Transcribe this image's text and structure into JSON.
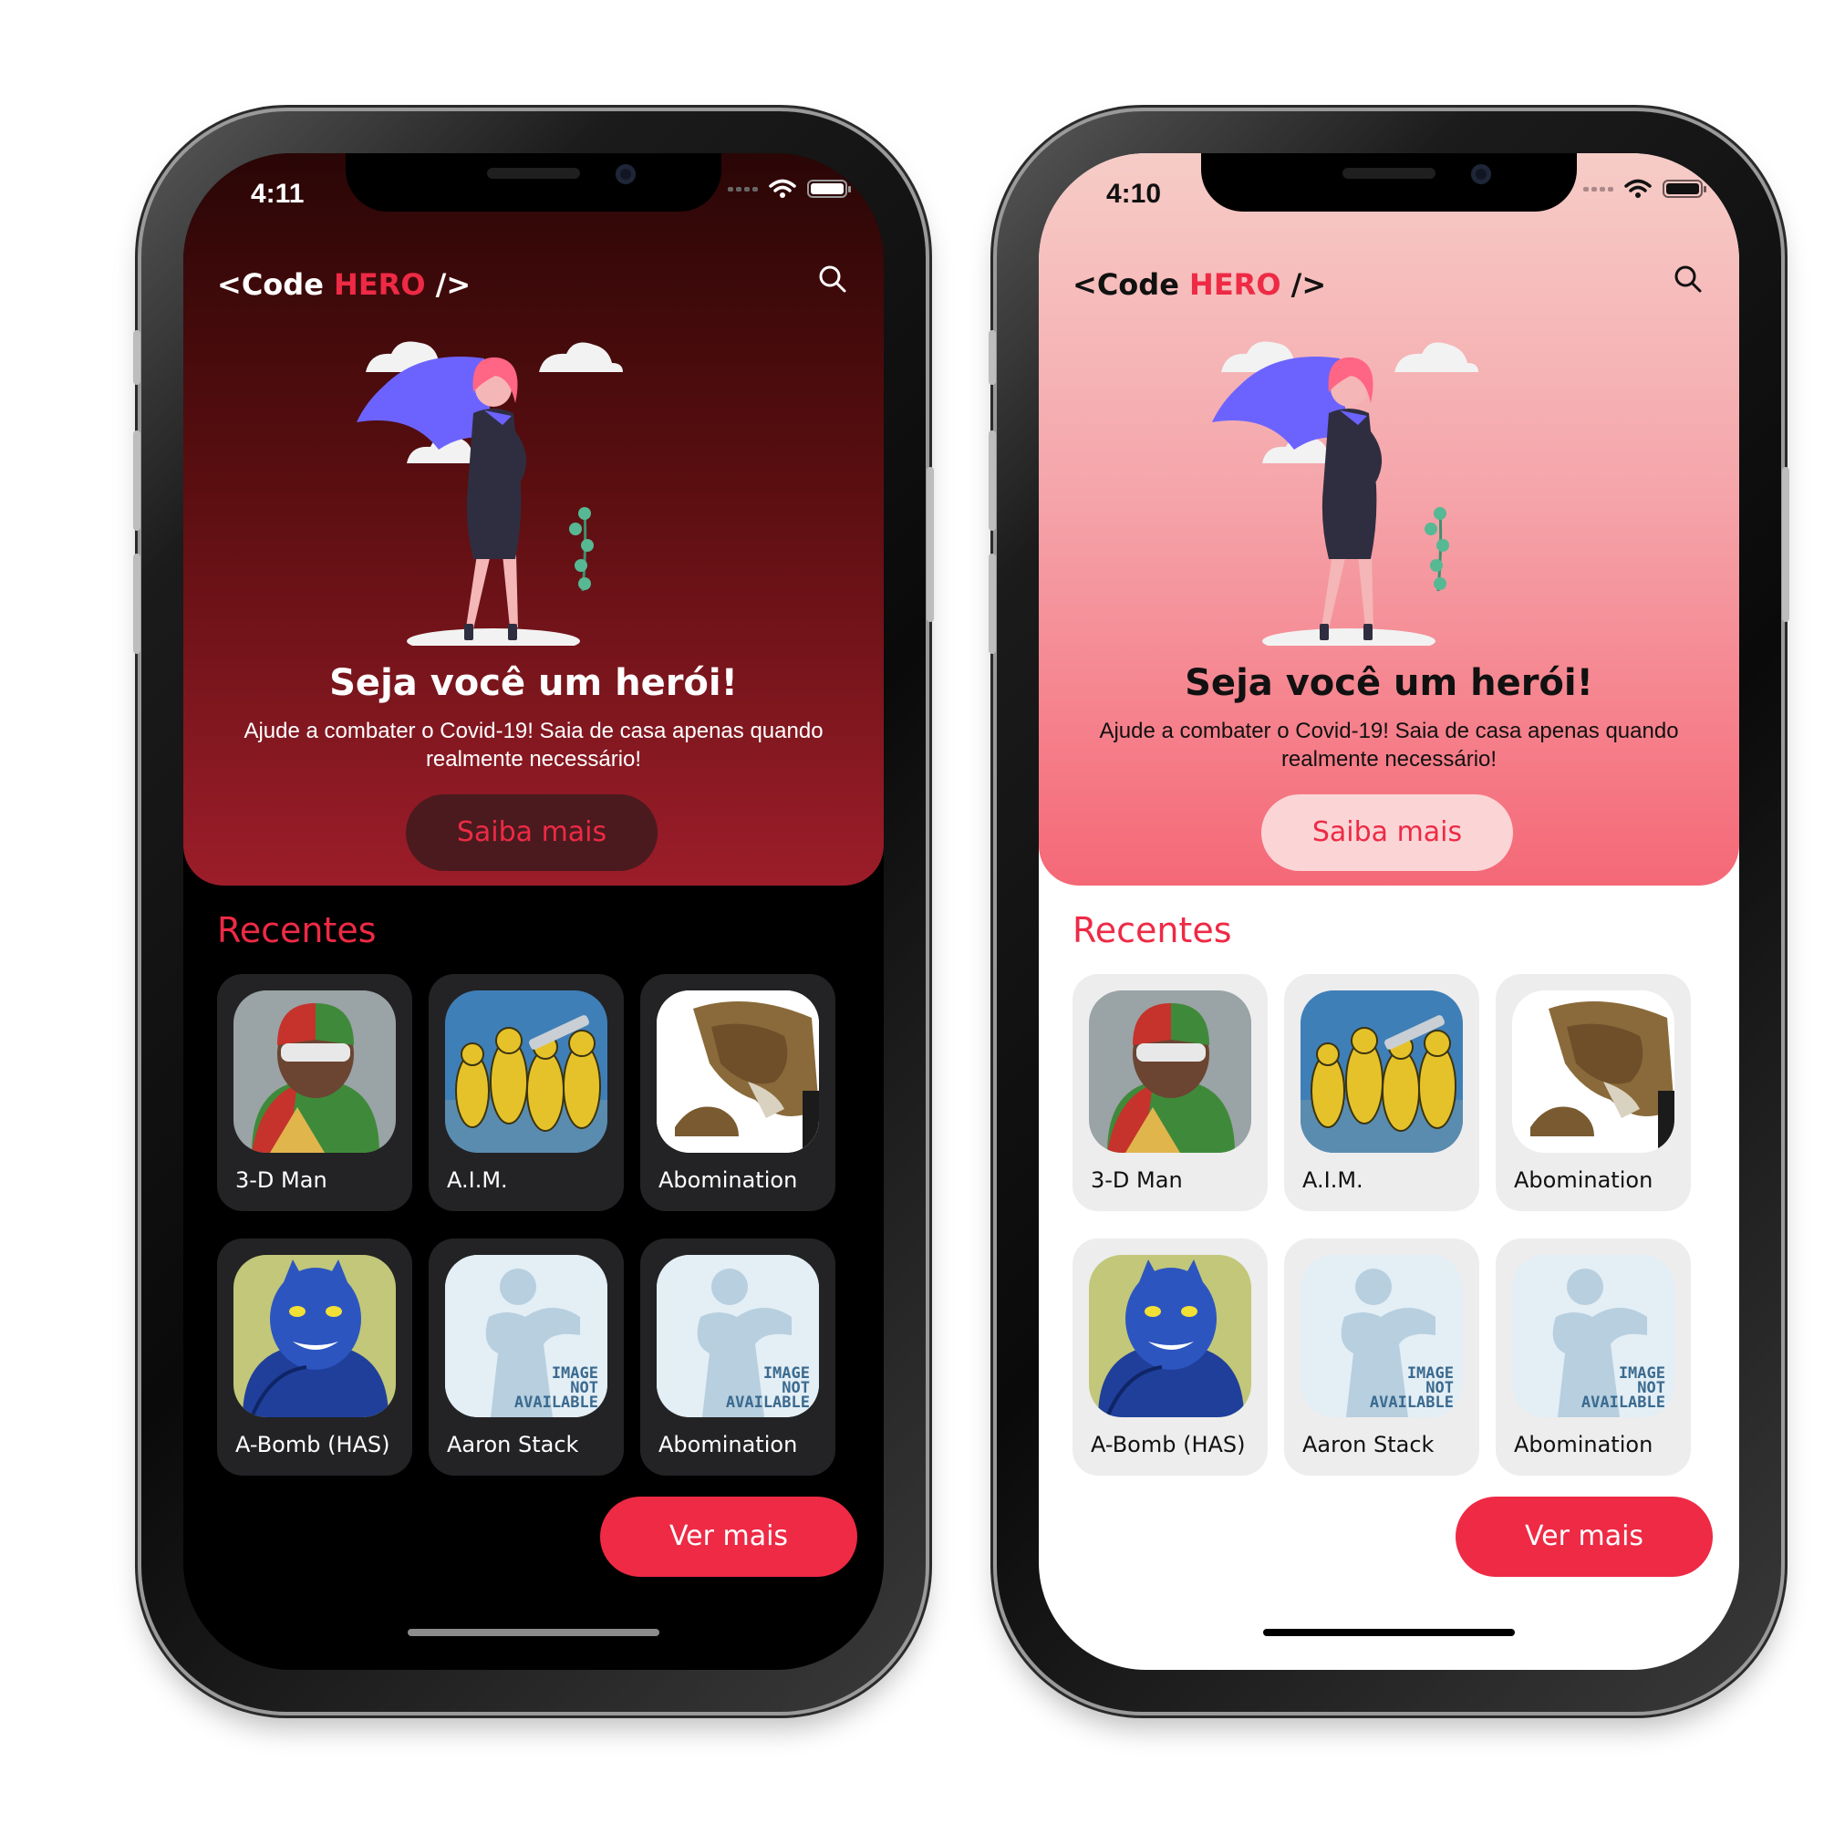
{
  "brand_color": "#ee2a45",
  "phones": [
    {
      "theme": "dark",
      "status": {
        "time": "4:11"
      },
      "header": {
        "title_prefix": "<Code ",
        "title_highlight": "HERO",
        "title_suffix": " />"
      },
      "hero": {
        "title": "Seja você um herói!",
        "subtitle": "Ajude a combater o Covid-19! Saia de casa apenas quando realmente necessário!",
        "button_label": "Saiba mais"
      },
      "section_title": "Recentes",
      "cards": [
        {
          "name": "3-D Man",
          "image": "3d-man"
        },
        {
          "name": "A.I.M.",
          "image": "aim"
        },
        {
          "name": "Abomination",
          "image": "abomination"
        },
        {
          "name": "A-Bomb (HAS)",
          "image": "a-bomb"
        },
        {
          "name": "Aaron Stack",
          "image": "image-not-available"
        },
        {
          "name": "Abomination",
          "image": "image-not-available"
        }
      ],
      "more_button_label": "Ver mais"
    },
    {
      "theme": "light",
      "status": {
        "time": "4:10"
      },
      "header": {
        "title_prefix": "<Code ",
        "title_highlight": "HERO",
        "title_suffix": " />"
      },
      "hero": {
        "title": "Seja você um herói!",
        "subtitle": "Ajude a combater o Covid-19! Saia de casa apenas quando realmente necessário!",
        "button_label": "Saiba mais"
      },
      "section_title": "Recentes",
      "cards": [
        {
          "name": "3-D Man",
          "image": "3d-man"
        },
        {
          "name": "A.I.M.",
          "image": "aim"
        },
        {
          "name": "Abomination",
          "image": "abomination"
        },
        {
          "name": "A-Bomb (HAS)",
          "image": "a-bomb"
        },
        {
          "name": "Aaron Stack",
          "image": "image-not-available"
        },
        {
          "name": "Abomination",
          "image": "image-not-available"
        }
      ],
      "more_button_label": "Ver mais"
    }
  ],
  "not_available_text": [
    "IMAGE",
    "NOT",
    "AVAILABLE"
  ]
}
